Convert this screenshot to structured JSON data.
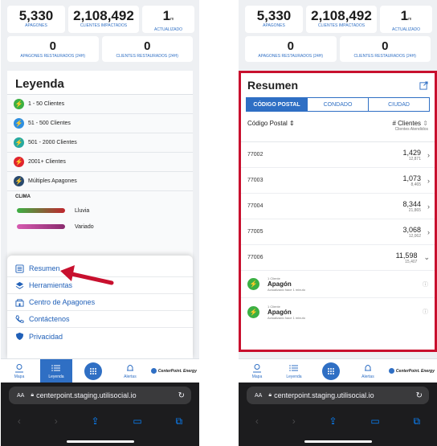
{
  "stats": {
    "apagones": "5,330",
    "apagones_label": "APAGONES",
    "clientes": "2,108,492",
    "clientes_label": "CLIENTES IMPACTADOS",
    "actualizado": "1",
    "actualizado_unit": "m",
    "actualizado_label": "ACTUALIZADO",
    "restaurados": "0",
    "restaurados_label": "APAGONES RESTAURADOS (24H)",
    "clientes_rest": "0",
    "clientes_rest_label": "CLIENTES RESTAURADOS (24H)"
  },
  "legend": {
    "title": "Leyenda",
    "items": [
      {
        "label": "1 - 50 Clientes",
        "color": "#3cb043"
      },
      {
        "label": "51 - 500 Clientes",
        "color": "#2f8fe0"
      },
      {
        "label": "501 - 2000 Clientes",
        "color": "#26a9a0"
      },
      {
        "label": "2001+ Clientes",
        "color": "#e0242e"
      },
      {
        "label": "Múltiples Apagones",
        "color": "#2a4a6e"
      }
    ],
    "clima_label": "CLIMA",
    "clima": [
      {
        "label": "Lluvia",
        "color": "#c0262e"
      },
      {
        "label": "Variado",
        "color": "#b23a8f"
      }
    ]
  },
  "menu": {
    "items": [
      {
        "label": "Resumen",
        "icon": "list-icon"
      },
      {
        "label": "Herramientas",
        "icon": "layers-icon"
      },
      {
        "label": "Centro de Apagones",
        "icon": "building-icon"
      },
      {
        "label": "Contáctenos",
        "icon": "phone-icon"
      },
      {
        "label": "Privacidad",
        "icon": "shield-icon"
      }
    ]
  },
  "tabbar": {
    "mapa": "Mapa",
    "leyenda": "Leyenda",
    "alertas": "Alertas",
    "brand": "CenterPoint. Energy"
  },
  "browser": {
    "aa": "AA",
    "url": "centerpoint.staging.utilisocial.io"
  },
  "resumen": {
    "title": "Resumen",
    "tabs": [
      "CÓDIGO POSTAL",
      "CONDADO",
      "CIUDAD"
    ],
    "col_postal": "Código Postal",
    "col_clientes": "# Clientes",
    "col_clientes_sub": "Clientes Atendidos",
    "rows": [
      {
        "zip": "77002",
        "v1": "1,429",
        "v2": "12,871"
      },
      {
        "zip": "77003",
        "v1": "1,073",
        "v2": "8,465"
      },
      {
        "zip": "77004",
        "v1": "8,344",
        "v2": "21,865"
      },
      {
        "zip": "77005",
        "v1": "3,068",
        "v2": "12,062"
      },
      {
        "zip": "77006",
        "v1": "11,598",
        "v2": "15,407"
      }
    ],
    "outages": [
      {
        "count": "1 Cliente",
        "title": "Apagón",
        "updated": "Actualizado hace 1 minuto"
      },
      {
        "count": "1 Cliente",
        "title": "Apagón",
        "updated": "Actualizado hace 1 minuto"
      }
    ]
  },
  "colors": {
    "accent": "#2f6fc4",
    "highlight": "#c8102e",
    "arrow": "#c8102e"
  }
}
